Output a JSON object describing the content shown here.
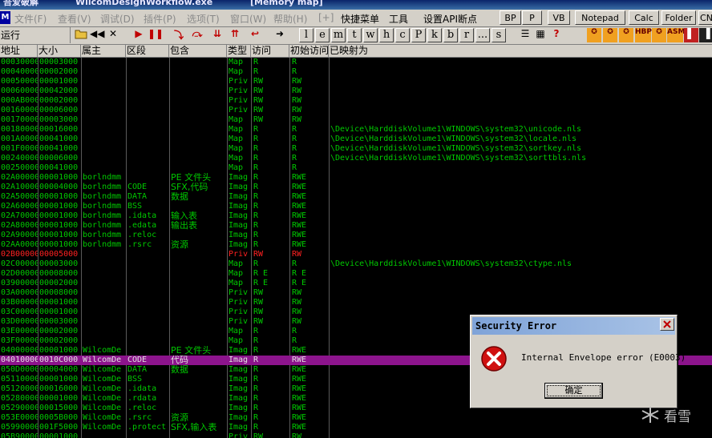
{
  "window": {
    "app_title": "吾爱破解",
    "file_name": "WilcomDesignWorkflow.exe",
    "window_label": "[Memory map]"
  },
  "menu": {
    "app_icon": "M",
    "items": [
      "文件(F)",
      "查看(V)",
      "调试(D)",
      "插件(P)",
      "选项(T)",
      "窗口(W)",
      "帮助(H)",
      "[+]",
      "快捷菜单",
      "工具",
      "设置API断点"
    ],
    "quick_buttons": [
      "BP",
      "P",
      "VB",
      "Notepad",
      "Calc",
      "Folder",
      "CN"
    ]
  },
  "toolbar": {
    "status": "运行",
    "letters": [
      "l",
      "e",
      "m",
      "t",
      "w",
      "h",
      "c",
      "P",
      "k",
      "b",
      "r",
      "...",
      "s"
    ],
    "plugin_labels": [
      "HBP",
      "ASM"
    ]
  },
  "columns": [
    "地址",
    "大小",
    "属主",
    "区段",
    "包含",
    "类型",
    "访问",
    "初始访问",
    "已映射为"
  ],
  "rows": [
    {
      "addr": "00030000",
      "size": "00003000",
      "owner": "",
      "section": "",
      "contains": "",
      "type": "Map",
      "access": "R",
      "initial": "R",
      "mapped": ""
    },
    {
      "addr": "00040000",
      "size": "00002000",
      "owner": "",
      "section": "",
      "contains": "",
      "type": "Map",
      "access": "R",
      "initial": "R",
      "mapped": ""
    },
    {
      "addr": "00050000",
      "size": "00001000",
      "owner": "",
      "section": "",
      "contains": "",
      "type": "Priv",
      "access": "RW",
      "initial": "RW",
      "mapped": ""
    },
    {
      "addr": "00060000",
      "size": "00042000",
      "owner": "",
      "section": "",
      "contains": "",
      "type": "Priv",
      "access": "RW",
      "initial": "RW",
      "mapped": ""
    },
    {
      "addr": "000AB000",
      "size": "00002000",
      "owner": "",
      "section": "",
      "contains": "",
      "type": "Priv",
      "access": "RW",
      "initial": "RW",
      "mapped": ""
    },
    {
      "addr": "00160000",
      "size": "00006000",
      "owner": "",
      "section": "",
      "contains": "",
      "type": "Priv",
      "access": "RW",
      "initial": "RW",
      "mapped": ""
    },
    {
      "addr": "00170000",
      "size": "00003000",
      "owner": "",
      "section": "",
      "contains": "",
      "type": "Map",
      "access": "RW",
      "initial": "RW",
      "mapped": ""
    },
    {
      "addr": "00180000",
      "size": "00016000",
      "owner": "",
      "section": "",
      "contains": "",
      "type": "Map",
      "access": "R",
      "initial": "R",
      "mapped": "\\Device\\HarddiskVolume1\\WINDOWS\\system32\\unicode.nls"
    },
    {
      "addr": "001A0000",
      "size": "00041000",
      "owner": "",
      "section": "",
      "contains": "",
      "type": "Map",
      "access": "R",
      "initial": "R",
      "mapped": "\\Device\\HarddiskVolume1\\WINDOWS\\system32\\locale.nls"
    },
    {
      "addr": "001F0000",
      "size": "00041000",
      "owner": "",
      "section": "",
      "contains": "",
      "type": "Map",
      "access": "R",
      "initial": "R",
      "mapped": "\\Device\\HarddiskVolume1\\WINDOWS\\system32\\sortkey.nls"
    },
    {
      "addr": "00240000",
      "size": "00006000",
      "owner": "",
      "section": "",
      "contains": "",
      "type": "Map",
      "access": "R",
      "initial": "R",
      "mapped": "\\Device\\HarddiskVolume1\\WINDOWS\\system32\\sorttbls.nls"
    },
    {
      "addr": "00250000",
      "size": "00041000",
      "owner": "",
      "section": "",
      "contains": "",
      "type": "Map",
      "access": "R",
      "initial": "R",
      "mapped": ""
    },
    {
      "addr": "02A00000",
      "size": "00001000",
      "owner": "borlndmm",
      "section": "",
      "contains": "PE 文件头",
      "type": "Imag",
      "access": "R",
      "initial": "RWE",
      "mapped": ""
    },
    {
      "addr": "02A10000",
      "size": "00004000",
      "owner": "borlndmm",
      "section": "CODE",
      "contains": "SFX,代码",
      "type": "Imag",
      "access": "R",
      "initial": "RWE",
      "mapped": ""
    },
    {
      "addr": "02A50000",
      "size": "00001000",
      "owner": "borlndmm",
      "section": "DATA",
      "contains": "数据",
      "type": "Imag",
      "access": "R",
      "initial": "RWE",
      "mapped": ""
    },
    {
      "addr": "02A60000",
      "size": "00001000",
      "owner": "borlndmm",
      "section": "BSS",
      "contains": "",
      "type": "Imag",
      "access": "R",
      "initial": "RWE",
      "mapped": ""
    },
    {
      "addr": "02A70000",
      "size": "00001000",
      "owner": "borlndmm",
      "section": ".idata",
      "contains": "输入表",
      "type": "Imag",
      "access": "R",
      "initial": "RWE",
      "mapped": ""
    },
    {
      "addr": "02A80000",
      "size": "00001000",
      "owner": "borlndmm",
      "section": ".edata",
      "contains": "输出表",
      "type": "Imag",
      "access": "R",
      "initial": "RWE",
      "mapped": ""
    },
    {
      "addr": "02A90000",
      "size": "00001000",
      "owner": "borlndmm",
      "section": ".reloc",
      "contains": "",
      "type": "Imag",
      "access": "R",
      "initial": "RWE",
      "mapped": ""
    },
    {
      "addr": "02AA0000",
      "size": "00001000",
      "owner": "borlndmm",
      "section": ".rsrc",
      "contains": "资源",
      "type": "Imag",
      "access": "R",
      "initial": "RWE",
      "mapped": ""
    },
    {
      "addr": "02B00000",
      "size": "00005000",
      "owner": "",
      "section": "",
      "contains": "",
      "type": "Priv",
      "access": "RW",
      "initial": "RW",
      "mapped": "",
      "highlight": true
    },
    {
      "addr": "02C00000",
      "size": "00003000",
      "owner": "",
      "section": "",
      "contains": "",
      "type": "Map",
      "access": "R",
      "initial": "R",
      "mapped": "\\Device\\HarddiskVolume1\\WINDOWS\\system32\\ctype.nls"
    },
    {
      "addr": "02D00000",
      "size": "00008000",
      "owner": "",
      "section": "",
      "contains": "",
      "type": "Map",
      "access": "R E",
      "initial": "R E",
      "mapped": ""
    },
    {
      "addr": "03900000",
      "size": "00002000",
      "owner": "",
      "section": "",
      "contains": "",
      "type": "Map",
      "access": "R E",
      "initial": "R E",
      "mapped": ""
    },
    {
      "addr": "03A00000",
      "size": "00008000",
      "owner": "",
      "section": "",
      "contains": "",
      "type": "Priv",
      "access": "RW",
      "initial": "RW",
      "mapped": ""
    },
    {
      "addr": "03B00000",
      "size": "00001000",
      "owner": "",
      "section": "",
      "contains": "",
      "type": "Priv",
      "access": "RW",
      "initial": "RW",
      "mapped": ""
    },
    {
      "addr": "03C00000",
      "size": "00001000",
      "owner": "",
      "section": "",
      "contains": "",
      "type": "Priv",
      "access": "RW",
      "initial": "RW",
      "mapped": ""
    },
    {
      "addr": "03D00000",
      "size": "00003000",
      "owner": "",
      "section": "",
      "contains": "",
      "type": "Priv",
      "access": "RW",
      "initial": "RW",
      "mapped": ""
    },
    {
      "addr": "03E00000",
      "size": "00002000",
      "owner": "",
      "section": "",
      "contains": "",
      "type": "Map",
      "access": "R",
      "initial": "R",
      "mapped": ""
    },
    {
      "addr": "03F00000",
      "size": "00002000",
      "owner": "",
      "section": "",
      "contains": "",
      "type": "Map",
      "access": "R",
      "initial": "R",
      "mapped": ""
    },
    {
      "addr": "04000000",
      "size": "00001000",
      "owner": "WilcomDe",
      "section": "",
      "contains": "PE 文件头",
      "type": "Imag",
      "access": "R",
      "initial": "RWE",
      "mapped": ""
    },
    {
      "addr": "04010000",
      "size": "0010C000",
      "owner": "WilcomDe",
      "section": "CODE",
      "contains": "代码",
      "type": "Imag",
      "access": "R",
      "initial": "RWE",
      "mapped": "",
      "selected": true
    },
    {
      "addr": "050D0000",
      "size": "00004000",
      "owner": "WilcomDe",
      "section": "DATA",
      "contains": "数据",
      "type": "Imag",
      "access": "R",
      "initial": "RWE",
      "mapped": ""
    },
    {
      "addr": "05110000",
      "size": "00001000",
      "owner": "WilcomDe",
      "section": "BSS",
      "contains": "",
      "type": "Imag",
      "access": "R",
      "initial": "RWE",
      "mapped": ""
    },
    {
      "addr": "05120000",
      "size": "00016000",
      "owner": "WilcomDe",
      "section": ".idata",
      "contains": "",
      "type": "Imag",
      "access": "R",
      "initial": "RWE",
      "mapped": ""
    },
    {
      "addr": "05280000",
      "size": "00001000",
      "owner": "WilcomDe",
      "section": ".rdata",
      "contains": "",
      "type": "Imag",
      "access": "R",
      "initial": "RWE",
      "mapped": ""
    },
    {
      "addr": "05290000",
      "size": "00015000",
      "owner": "WilcomDe",
      "section": ".reloc",
      "contains": "",
      "type": "Imag",
      "access": "R",
      "initial": "RWE",
      "mapped": ""
    },
    {
      "addr": "053E0000",
      "size": "0005B000",
      "owner": "WilcomDe",
      "section": ".rsrc",
      "contains": "资源",
      "type": "Imag",
      "access": "R",
      "initial": "RWE",
      "mapped": ""
    },
    {
      "addr": "05990000",
      "size": "001F5000",
      "owner": "WilcomDe",
      "section": ".protect",
      "contains": "SFX,输入表",
      "type": "Imag",
      "access": "R",
      "initial": "RWE",
      "mapped": ""
    },
    {
      "addr": "05B90000",
      "size": "00001000",
      "owner": "",
      "section": "",
      "contains": "",
      "type": "Priv",
      "access": "RW",
      "initial": "RW",
      "mapped": ""
    }
  ],
  "dialog": {
    "title": "Security Error",
    "message": "Internal Envelope error (E0003)",
    "ok_label": "确定"
  },
  "watermark": "看雪",
  "colors": {
    "grid_bg": "#000000",
    "grid_text": "#00c800",
    "highlight_text": "#ff2020",
    "selected_row": "#8c148c",
    "chrome": "#d4d0c8"
  }
}
